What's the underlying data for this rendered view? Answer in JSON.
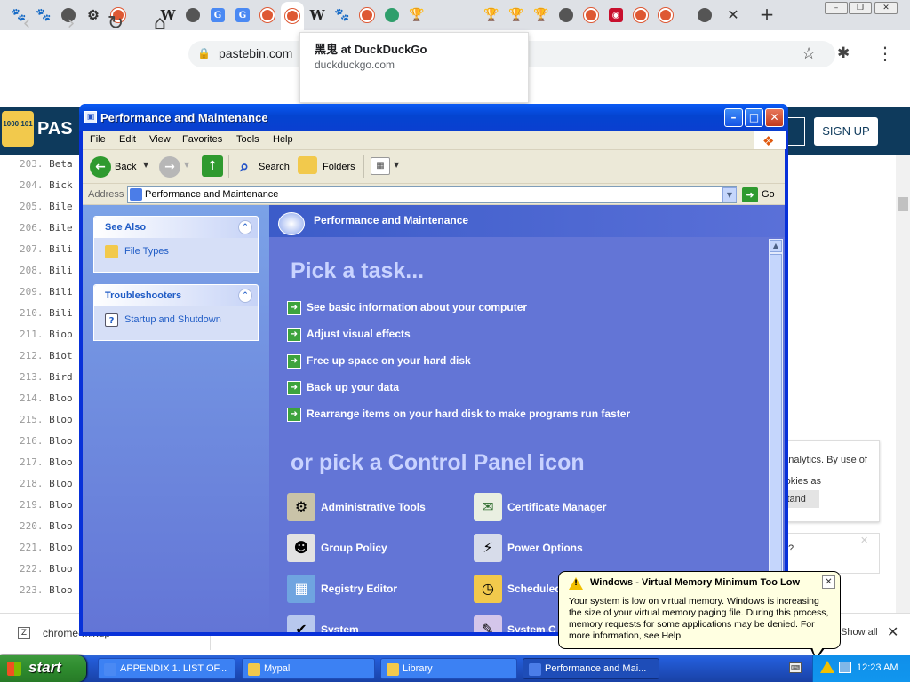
{
  "browser": {
    "tabs": [
      {
        "icon": "paw-icon"
      },
      {
        "icon": "paw-icon"
      },
      {
        "icon": "globe-icon"
      },
      {
        "icon": "gear-icon"
      },
      {
        "icon": "duckduckgo-icon"
      },
      {
        "icon": "wikipedia-icon"
      },
      {
        "icon": "globe-icon"
      },
      {
        "icon": "translate-icon"
      },
      {
        "icon": "translate-icon"
      },
      {
        "icon": "duckduckgo-icon"
      },
      {
        "icon": "duckduckgo-icon"
      },
      {
        "icon": "wikipedia-icon"
      },
      {
        "icon": "paw-icon"
      },
      {
        "icon": "duckduckgo-icon"
      },
      {
        "icon": "green-icon"
      },
      {
        "icon": "trophy-icon"
      },
      {
        "icon": "trophy-icon"
      },
      {
        "icon": "trophy-icon"
      },
      {
        "icon": "trophy-icon"
      },
      {
        "icon": "globe-icon"
      },
      {
        "icon": "duckduckgo-icon"
      },
      {
        "icon": "red-icon"
      },
      {
        "icon": "duckduckgo-icon"
      },
      {
        "icon": "duckduckgo-icon"
      },
      {
        "icon": "globe-icon"
      }
    ],
    "url": "pastebin.com",
    "tooltip": {
      "title": "黑鬼 at DuckDuckGo",
      "url": "duckduckgo.com"
    },
    "download": {
      "file_name": "chrome-mixup",
      "show_all": "Show all"
    }
  },
  "pastebin": {
    "logo_name": "PAS",
    "logo_text": "1000 101",
    "signup": "SIGN UP",
    "lines": [
      {
        "num": "203.",
        "text": "Beta"
      },
      {
        "num": "204.",
        "text": "Bick"
      },
      {
        "num": "205.",
        "text": "Bile"
      },
      {
        "num": "206.",
        "text": "Bile"
      },
      {
        "num": "207.",
        "text": "Bili"
      },
      {
        "num": "208.",
        "text": "Bili"
      },
      {
        "num": "209.",
        "text": "Bili"
      },
      {
        "num": "210.",
        "text": "Bili"
      },
      {
        "num": "211.",
        "text": "Biop"
      },
      {
        "num": "212.",
        "text": "Biot"
      },
      {
        "num": "213.",
        "text": "Bird"
      },
      {
        "num": "214.",
        "text": "Bloo"
      },
      {
        "num": "215.",
        "text": "Bloo"
      },
      {
        "num": "216.",
        "text": "Bloo"
      },
      {
        "num": "217.",
        "text": "Bloo"
      },
      {
        "num": "218.",
        "text": "Bloo"
      },
      {
        "num": "219.",
        "text": "Bloo"
      },
      {
        "num": "220.",
        "text": "Bloo"
      },
      {
        "num": "221.",
        "text": "Bloo"
      },
      {
        "num": "222.",
        "text": "Bloo"
      },
      {
        "num": "223.",
        "text": "Bloo"
      }
    ],
    "cookie_text": "g analytics. By use of cookies as",
    "cookie_button": "stand",
    "cookie2_text": "t?"
  },
  "window": {
    "title": "Performance and Maintenance",
    "menu": [
      "File",
      "Edit",
      "View",
      "Favorites",
      "Tools",
      "Help"
    ],
    "toolbar": {
      "back": "Back",
      "search": "Search",
      "folders": "Folders"
    },
    "address": {
      "label": "Address",
      "value": "Performance and Maintenance",
      "go": "Go"
    },
    "see_also": {
      "title": "See Also",
      "items": [
        {
          "label": "File Types",
          "icon": "file-types-icon"
        }
      ]
    },
    "troubleshooters": {
      "title": "Troubleshooters",
      "items": [
        {
          "label": "Startup and Shutdown",
          "icon": "help-icon"
        }
      ]
    },
    "main": {
      "header": "Performance and Maintenance",
      "pick_task": "Pick a task...",
      "tasks": [
        "See basic information about your computer",
        "Adjust visual effects",
        "Free up space on your hard disk",
        "Back up your data",
        "Rearrange items on your hard disk to make programs run faster"
      ],
      "pick_icon": "or pick a Control Panel icon",
      "icons": [
        {
          "label": "Administrative Tools",
          "icon": "administrative-tools-icon"
        },
        {
          "label": "Certificate Manager",
          "icon": "certificate-icon"
        },
        {
          "label": "Group Policy",
          "icon": "group-policy-icon"
        },
        {
          "label": "Power Options",
          "icon": "power-options-icon"
        },
        {
          "label": "Registry Editor",
          "icon": "registry-editor-icon"
        },
        {
          "label": "Scheduled",
          "icon": "scheduled-tasks-icon"
        },
        {
          "label": "System",
          "icon": "system-icon"
        },
        {
          "label": "System C",
          "icon": "system-icon"
        }
      ]
    }
  },
  "balloon": {
    "title": "Windows - Virtual Memory Minimum Too Low",
    "text": "Your system is low on virtual memory. Windows is increasing the size of your virtual memory paging file. During this process, memory requests for some applications may be denied. For more information, see Help."
  },
  "taskbar": {
    "start": "start",
    "tasks": [
      {
        "label": "APPENDIX 1. LIST OF...",
        "active": false
      },
      {
        "label": "Mypal",
        "active": false
      },
      {
        "label": "Library",
        "active": false
      },
      {
        "label": "Performance and Mai...",
        "active": true
      }
    ],
    "clock": "12:23 AM"
  }
}
